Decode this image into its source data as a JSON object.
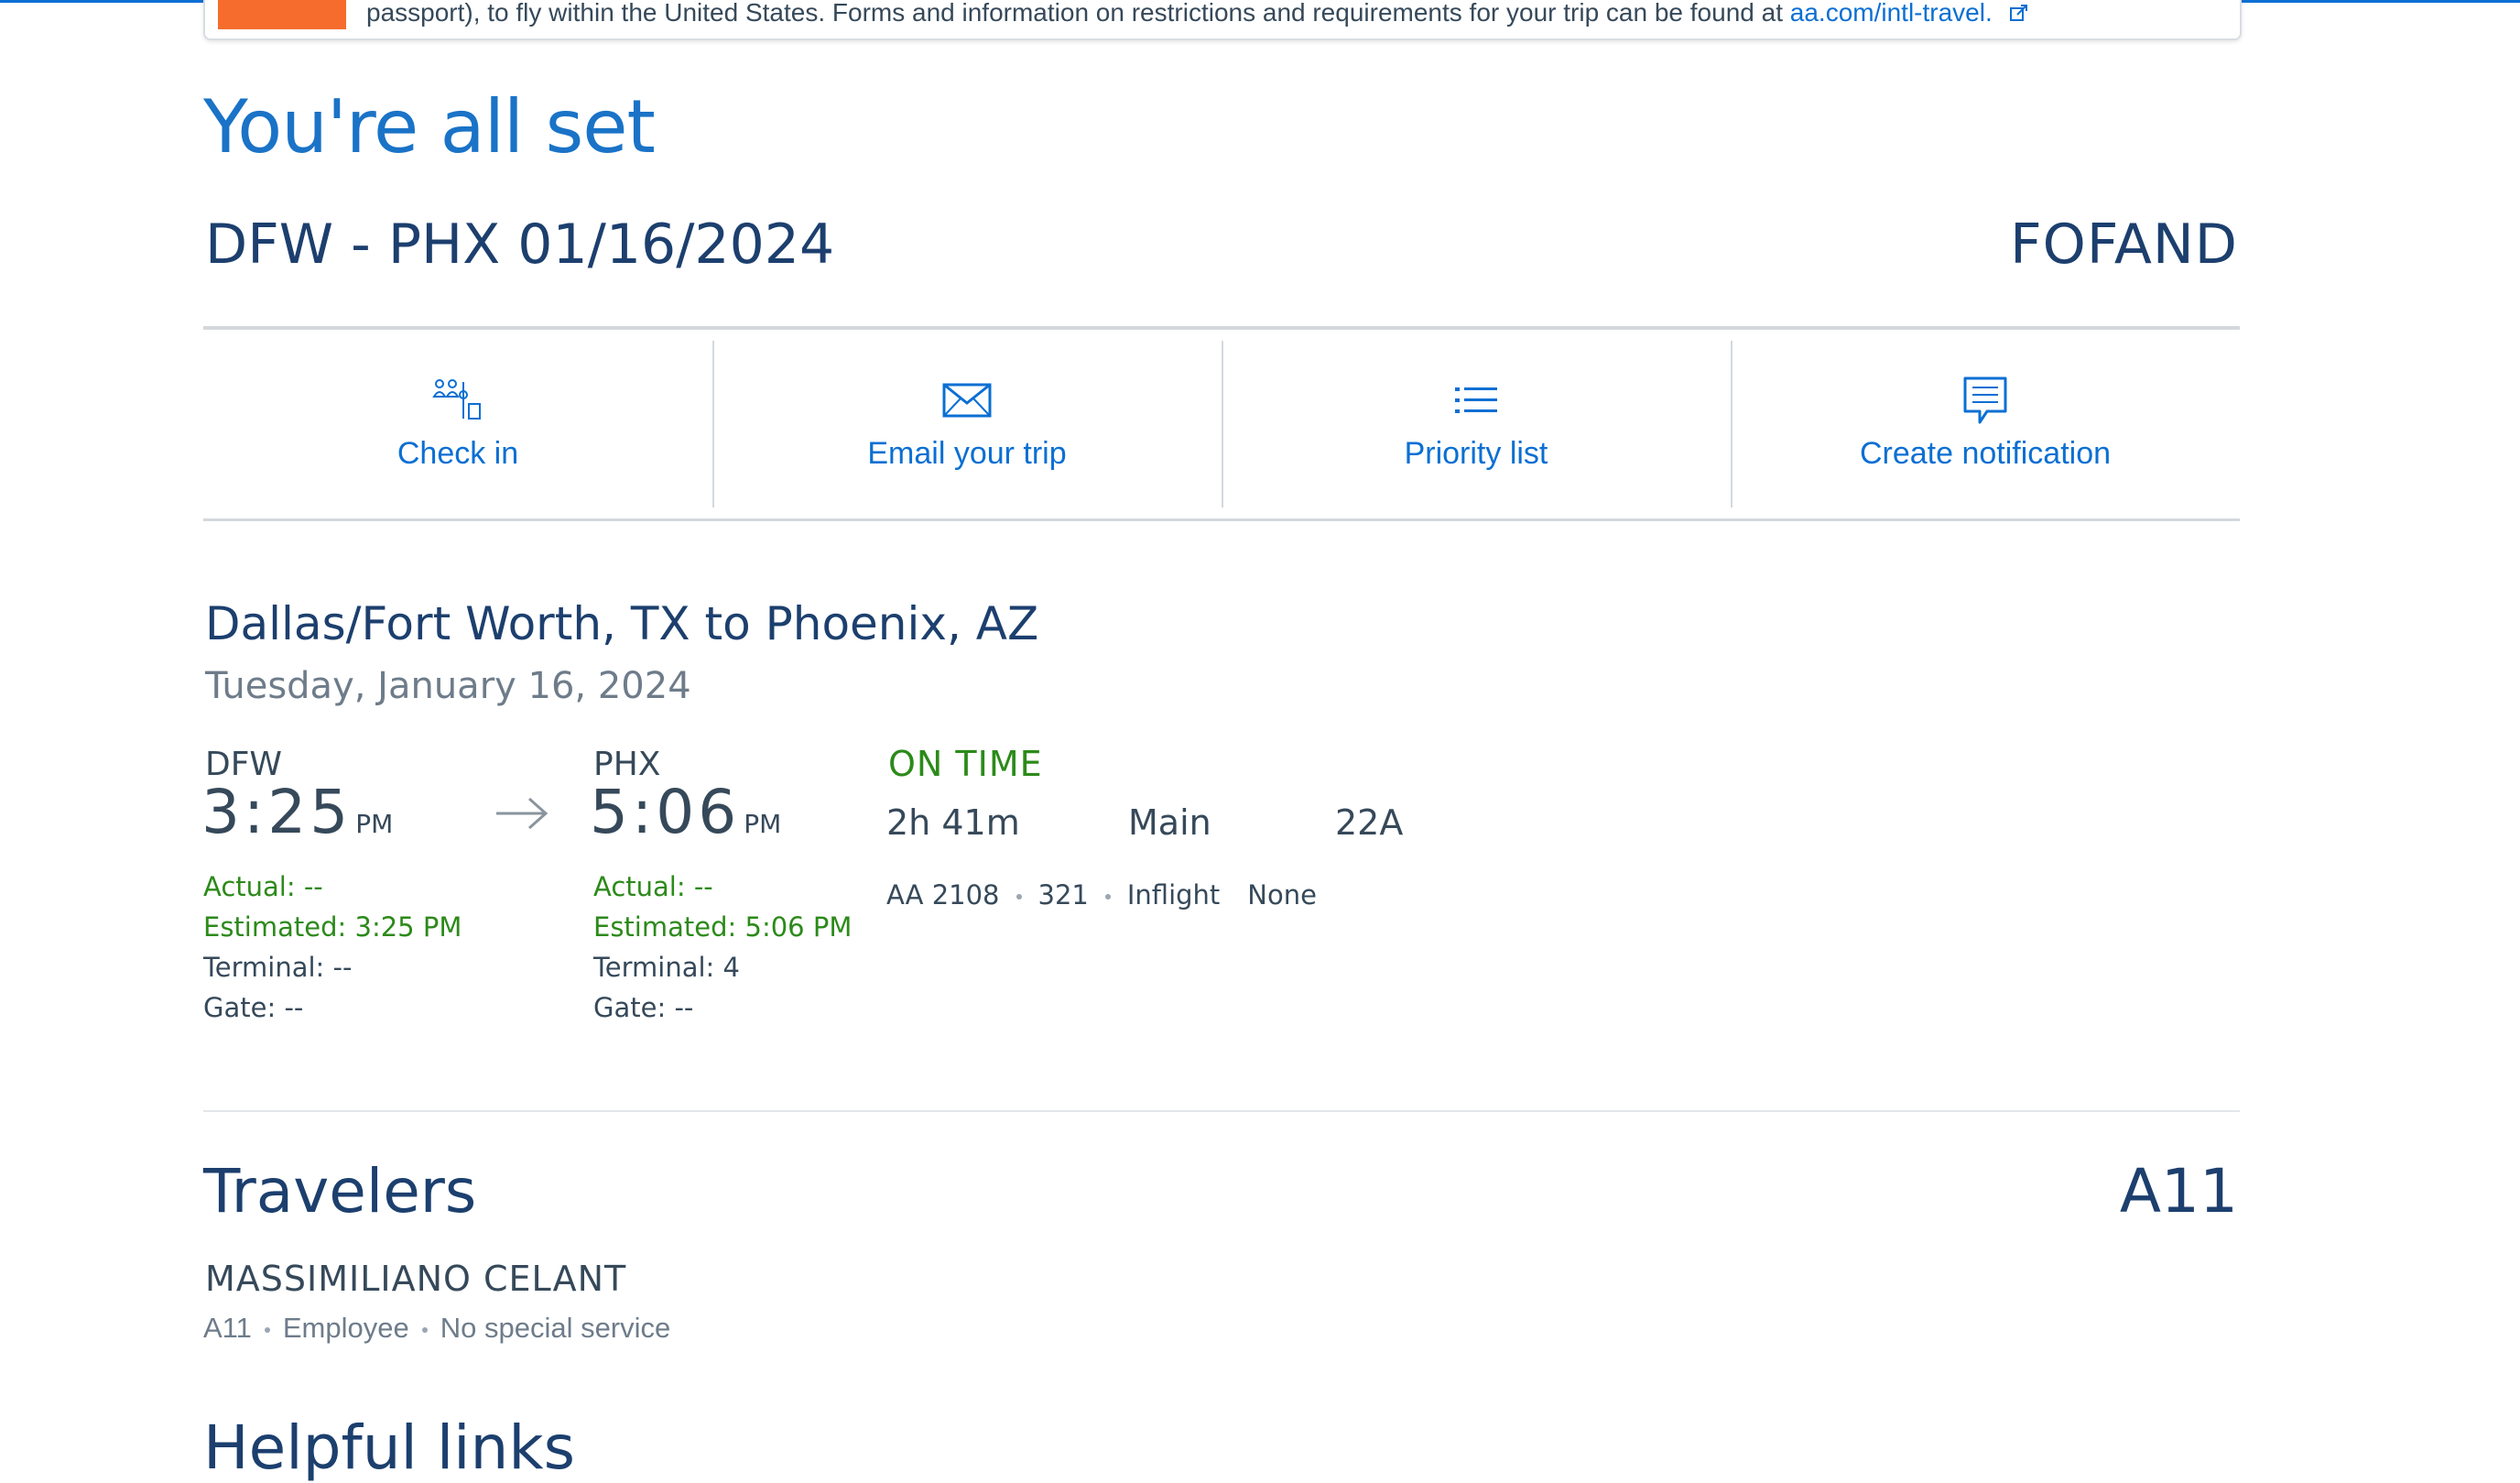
{
  "alert": {
    "text": "passport), to fly within the United States. Forms and information on restrictions and requirements for your trip can be found at",
    "link": "aa.com/intl-travel."
  },
  "confirmation": {
    "heading": "You're all set",
    "route_title": "DFW - PHX 01/16/2024",
    "record_locator": "FOFAND"
  },
  "actions": [
    {
      "label": "Check in",
      "icon": "check-in-icon"
    },
    {
      "label": "Email your trip",
      "icon": "envelope-icon"
    },
    {
      "label": "Priority list",
      "icon": "list-icon"
    },
    {
      "label": "Create notification",
      "icon": "chat-bubble-icon"
    }
  ],
  "leg": {
    "title": "Dallas/Fort Worth, TX to Phoenix, AZ",
    "date": "Tuesday, January 16, 2024",
    "depart": {
      "code": "DFW",
      "time": "3:25",
      "ampm": "PM",
      "actual": "Actual: --",
      "estimated": "Estimated: 3:25 PM",
      "terminal": "Terminal: --",
      "gate": "Gate: --"
    },
    "arrive": {
      "code": "PHX",
      "time": "5:06",
      "ampm": "PM",
      "actual": "Actual: --",
      "estimated": "Estimated: 5:06 PM",
      "terminal": "Terminal: 4",
      "gate": "Gate: --"
    },
    "status": "ON TIME",
    "duration": "2h 41m",
    "cabin": "Main",
    "seat": "22A",
    "flight": "AA 2108",
    "aircraft": "321",
    "inflight_label": "Inflight",
    "inflight_value": "None"
  },
  "travelers": {
    "title": "Travelers",
    "seat": "A11",
    "items": [
      {
        "name": "MASSIMILIANO CELANT",
        "seat": "A11",
        "type": "Employee",
        "service": "No special service"
      }
    ]
  },
  "helpful_links": {
    "title": "Helpful links"
  },
  "colors": {
    "brand_blue": "#0b6fd3",
    "heading_blue": "#1a73c7",
    "navy": "#1c3f6e",
    "status_green": "#2c8a1a",
    "alert_orange": "#f56c2d"
  }
}
